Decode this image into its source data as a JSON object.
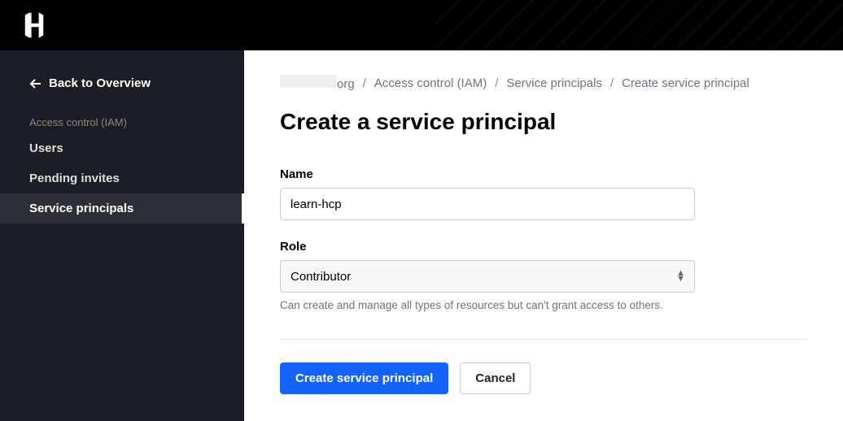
{
  "sidebar": {
    "back_label": "Back to Overview",
    "section_label": "Access control (IAM)",
    "items": [
      {
        "label": "Users"
      },
      {
        "label": "Pending invites"
      },
      {
        "label": "Service principals"
      }
    ]
  },
  "breadcrumb": {
    "org_suffix": "org",
    "items": [
      "Access control (IAM)",
      "Service principals",
      "Create service principal"
    ]
  },
  "page_title": "Create a service principal",
  "form": {
    "name_label": "Name",
    "name_value": "learn-hcp",
    "role_label": "Role",
    "role_value": "Contributor",
    "role_help": "Can create and manage all types of resources but can't grant access to others."
  },
  "buttons": {
    "primary": "Create service principal",
    "cancel": "Cancel"
  }
}
